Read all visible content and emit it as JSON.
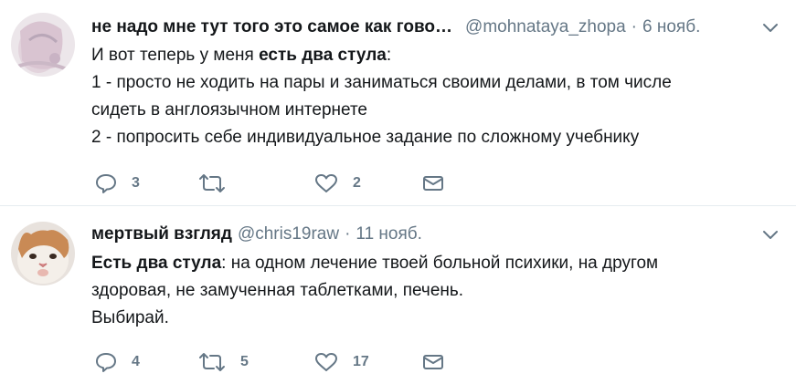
{
  "tweets": [
    {
      "fullname": "не надо мне тут того это самое как гово…",
      "username": "@mohnataya_zhopa",
      "separator": "·",
      "time": "6 нояб.",
      "text": {
        "line1_prefix": "И вот теперь у меня ",
        "line1_bold": "есть два стула",
        "line1_suffix": ":",
        "line2": "1 - просто не ходить на пары и заниматься своими делами, в том числе сидеть в англоязычном интернете",
        "line3": "2 - попросить себе индивидуальное задание по сложному учебнику"
      },
      "counts": {
        "replies": "3",
        "retweets": "",
        "likes": "2"
      }
    },
    {
      "fullname": "мертвый взгляд",
      "username": "@chris19raw",
      "separator": "·",
      "time": "11 нояб.",
      "text": {
        "line1_bold": "Есть два стула",
        "line1_suffix": ": на одном лечение твоей больной психики, на другом здоровая, не замученная таблетками, печень.",
        "line2": "Выбирай."
      },
      "counts": {
        "replies": "4",
        "retweets": "5",
        "likes": "17"
      }
    }
  ],
  "icons": {
    "reply": "reply-icon",
    "retweet": "retweet-icon",
    "like": "heart-icon",
    "dm": "envelope-icon",
    "caret": "chevron-down-icon"
  },
  "colors": {
    "icon": "#657786",
    "text": "#14171a",
    "divider": "#e6ecf0"
  }
}
